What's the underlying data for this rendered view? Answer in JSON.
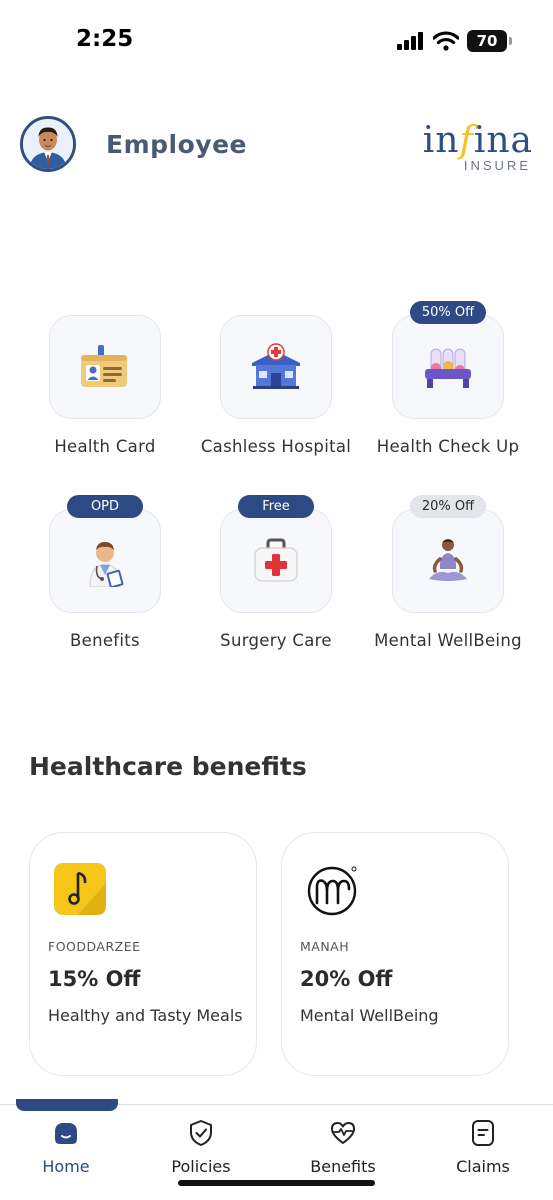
{
  "status_bar": {
    "time": "2:25",
    "battery": "70"
  },
  "header": {
    "user_name": "Employee",
    "logo_main_pre": "in",
    "logo_main_f": "f",
    "logo_main_post": "ina",
    "logo_sub": "INSURE"
  },
  "services": [
    {
      "label": "Health Card",
      "badge": ""
    },
    {
      "label": "Cashless Hospital",
      "badge": ""
    },
    {
      "label": "Health Check Up",
      "badge": "50% Off"
    },
    {
      "label": "Benefits",
      "badge": "OPD"
    },
    {
      "label": "Surgery Care",
      "badge": "Free"
    },
    {
      "label": "Mental WellBeing",
      "badge": "20% Off"
    }
  ],
  "benefits_section": {
    "title": "Healthcare benefits",
    "cards": [
      {
        "brand": "FOODDARZEE",
        "offer": "15% Off",
        "description": "Healthy and Tasty Meals"
      },
      {
        "brand": "MANAH",
        "offer": "20% Off",
        "description": "Mental WellBeing"
      }
    ]
  },
  "nav": {
    "items": [
      {
        "label": "Home"
      },
      {
        "label": "Policies"
      },
      {
        "label": "Benefits"
      },
      {
        "label": "Claims"
      }
    ]
  },
  "colors": {
    "brand_blue": "#2d4a85",
    "logo_yellow": "#f2c31a",
    "foodarzee_yellow": "#f5c518"
  }
}
